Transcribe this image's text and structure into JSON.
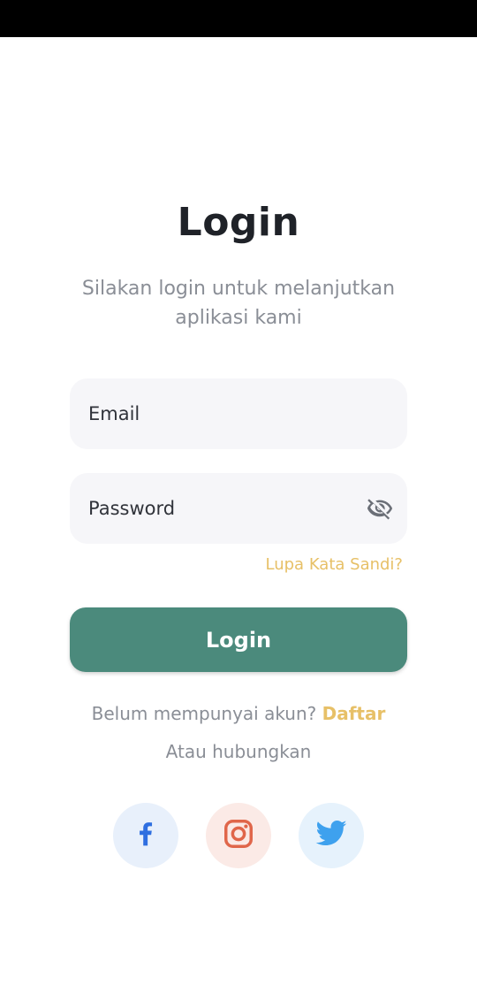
{
  "page": {
    "title": "Login",
    "subtitle": "Silakan login untuk melanjutkan aplikasi kami"
  },
  "form": {
    "email_placeholder": "Email",
    "email_value": "",
    "password_placeholder": "Password",
    "password_value": "",
    "password_toggle_icon": "eye-off-icon",
    "forgot_label": "Lupa Kata Sandi?",
    "login_label": "Login"
  },
  "signup": {
    "prompt": "Belum mempunyai akun? ",
    "link_label": "Daftar"
  },
  "social": {
    "connect_label": "Atau hubungkan",
    "buttons": [
      {
        "name": "facebook",
        "icon": "facebook-icon",
        "color": "#2f6fe0"
      },
      {
        "name": "instagram",
        "icon": "instagram-icon",
        "color": "#e0664a"
      },
      {
        "name": "twitter",
        "icon": "twitter-icon",
        "color": "#3ea1ee"
      }
    ]
  },
  "colors": {
    "primary": "#4b8a7c",
    "accent": "#e7c067",
    "muted_text": "#8a8e96",
    "heading": "#1f2228",
    "field_bg": "#f6f6f9"
  }
}
